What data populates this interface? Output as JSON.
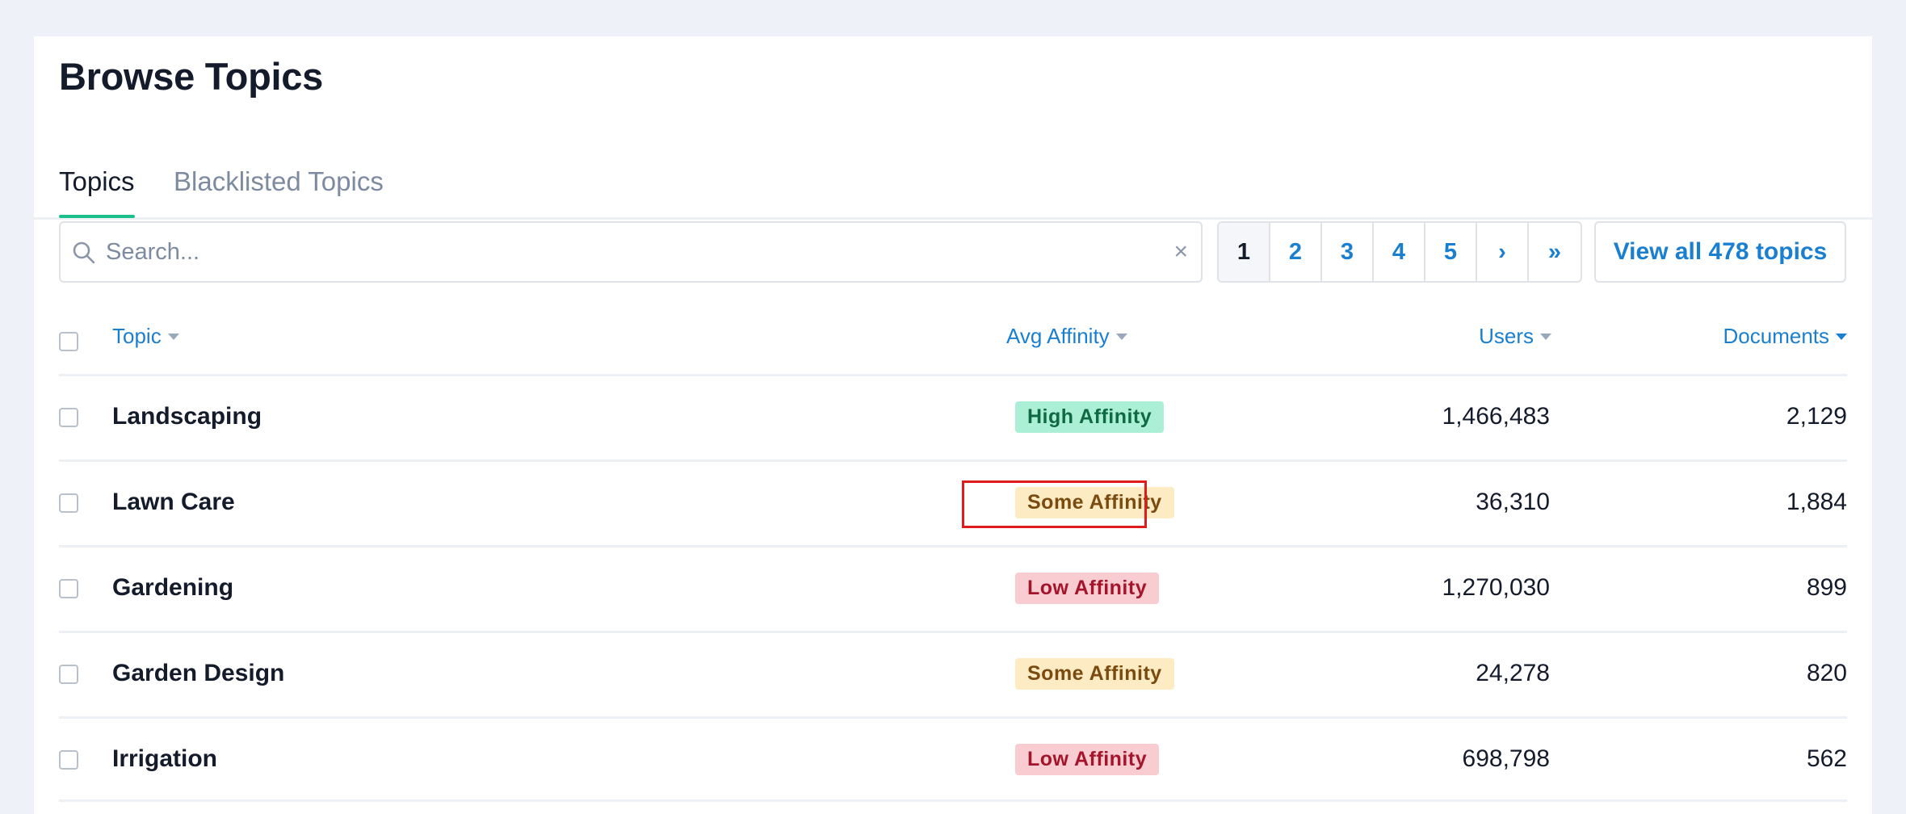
{
  "page": {
    "title": "Browse Topics"
  },
  "tabs": [
    {
      "label": "Topics",
      "active": true
    },
    {
      "label": "Blacklisted Topics",
      "active": false
    }
  ],
  "search": {
    "placeholder": "Search...",
    "value": "",
    "clear_icon": "×"
  },
  "pagination": {
    "pages": [
      "1",
      "2",
      "3",
      "4",
      "5"
    ],
    "current": "1",
    "next_label": "›",
    "last_label": "»"
  },
  "view_all_label": "View all 478 topics",
  "table": {
    "columns": {
      "topic": "Topic",
      "avg_affinity": "Avg Affinity",
      "users": "Users",
      "documents": "Documents"
    },
    "sorted_by": "documents",
    "rows": [
      {
        "topic": "Landscaping",
        "affinity": "High Affinity",
        "affinity_level": "high",
        "users": "1,466,483",
        "documents": "2,129"
      },
      {
        "topic": "Lawn Care",
        "affinity": "Some Affinity",
        "affinity_level": "some",
        "users": "36,310",
        "documents": "1,884"
      },
      {
        "topic": "Gardening",
        "affinity": "Low Affinity",
        "affinity_level": "low",
        "users": "1,270,030",
        "documents": "899"
      },
      {
        "topic": "Garden Design",
        "affinity": "Some Affinity",
        "affinity_level": "some",
        "users": "24,278",
        "documents": "820"
      },
      {
        "topic": "Irrigation",
        "affinity": "Low Affinity",
        "affinity_level": "low",
        "users": "698,798",
        "documents": "562"
      }
    ]
  },
  "colors": {
    "accent": "#1a7fd0",
    "tab_underline": "#1cc08a",
    "high_affinity_bg": "#abefd6",
    "some_affinity_bg": "#fdebc3",
    "low_affinity_bg": "#f9ccd2",
    "highlight_outline": "#e01b1b"
  }
}
